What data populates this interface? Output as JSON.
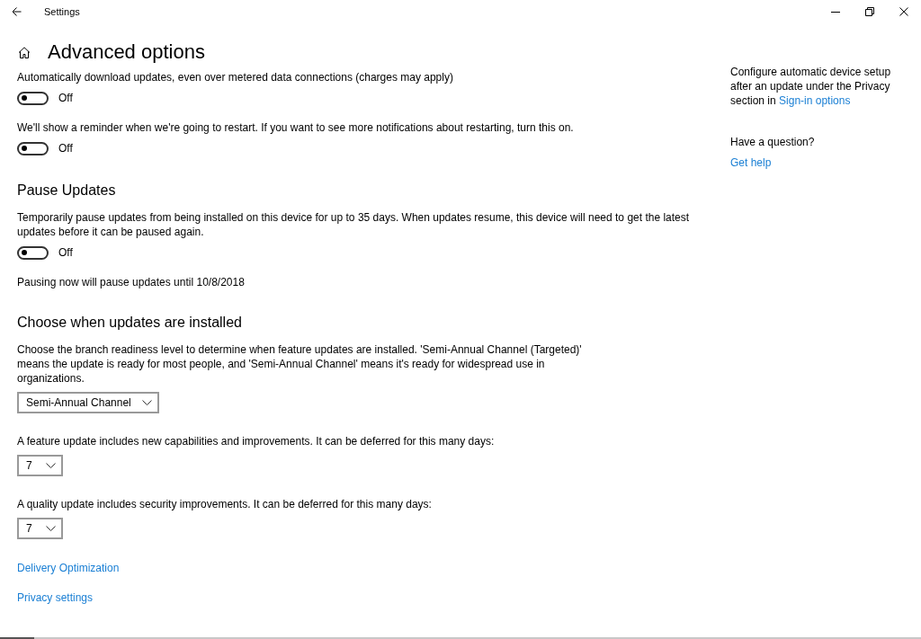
{
  "window": {
    "title": "Settings"
  },
  "page_title": "Advanced options",
  "sections": [
    {
      "items": [
        {
          "kind": "toggle",
          "description": "Automatically download updates, even over metered data connections (charges may apply)",
          "on": false,
          "state_label": "Off"
        },
        {
          "kind": "toggle",
          "description": "We'll show a reminder when we're going to restart. If you want to see more notifications about restarting, turn this on.",
          "on": false,
          "state_label": "Off"
        }
      ]
    },
    {
      "heading": "Pause Updates",
      "items": [
        {
          "kind": "toggle",
          "description": "Temporarily pause updates from being installed on this device for up to 35 days. When updates resume, this device will need to get the latest updates before it can be paused again.",
          "on": false,
          "state_label": "Off"
        },
        {
          "kind": "note",
          "text": "Pausing now will pause updates until 10/8/2018"
        }
      ]
    },
    {
      "heading": "Choose when updates are installed",
      "items": [
        {
          "kind": "dropdown",
          "description": "Choose the branch readiness level to determine when feature updates are installed. 'Semi-Annual Channel (Targeted)' means the update is ready for most people, and 'Semi-Annual Channel' means it's ready for widespread use in organizations.",
          "value": "Semi-Annual Channel"
        },
        {
          "kind": "dropdown",
          "description": "A feature update includes new capabilities and improvements. It can be deferred for this many days:",
          "value": "7"
        },
        {
          "kind": "dropdown",
          "description": "A quality update includes security improvements. It can be deferred for this many days:",
          "value": "7"
        }
      ]
    }
  ],
  "links": [
    "Delivery Optimization",
    "Privacy settings"
  ],
  "sidebar": {
    "text": "Configure automatic device setup after an update under the Privacy section in",
    "link": "Sign-in options",
    "question": "Have a question?",
    "help_link": "Get help"
  }
}
